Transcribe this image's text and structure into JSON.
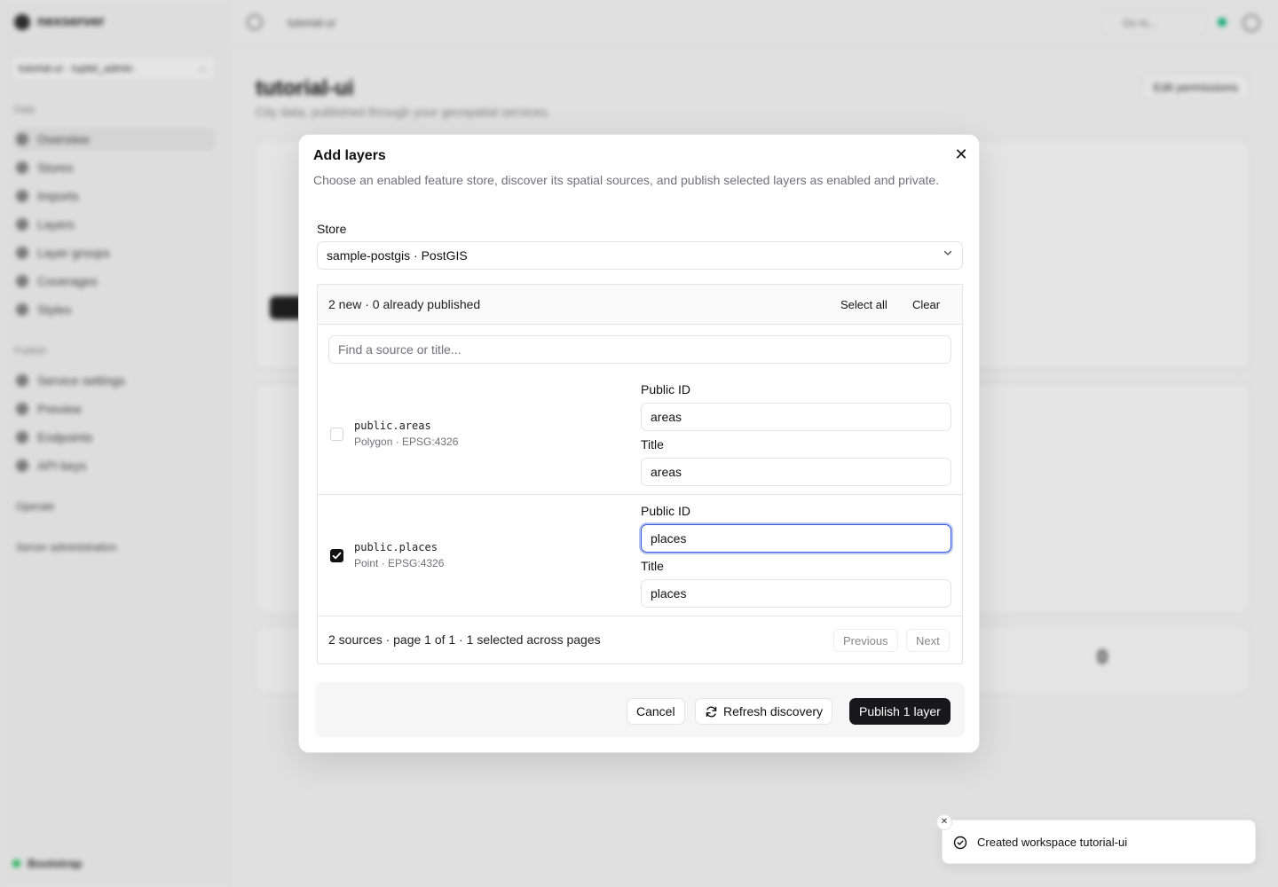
{
  "app": {
    "brand": "nexserver",
    "workspace_switcher": "tutorial-ui · tuplet_admin",
    "nav_group_data": "Data",
    "nav_items": [
      "Overview",
      "Stores",
      "Imports",
      "Layers",
      "Layer groups",
      "Coverages",
      "Styles"
    ],
    "nav_group_publish": "Publish",
    "publish_items": [
      "Service settings",
      "Preview",
      "Endpoints",
      "API keys"
    ],
    "extra_items": [
      "Operate",
      "Server administration"
    ],
    "footer_status": "Bootstrap",
    "breadcrumb": "tutorial-ui",
    "search_placeholder": "Go to...",
    "page_title": "tutorial-ui",
    "page_subtitle": "City data, published through your geospatial services.",
    "edit_permissions": "Edit permissions"
  },
  "dialog": {
    "title": "Add layers",
    "description": "Choose an enabled feature store, discover its spatial sources, and publish selected layers as enabled and private.",
    "store_label": "Store",
    "store_value": "sample-postgis · PostGIS",
    "summary": "2 new · 0 already published",
    "select_all": "Select all",
    "clear": "Clear",
    "find_placeholder": "Find a source or title...",
    "sources": [
      {
        "name": "public.areas",
        "meta": "Polygon · EPSG:4326",
        "checked": false,
        "public_id_label": "Public ID",
        "public_id": "areas",
        "title_label": "Title",
        "title": "areas"
      },
      {
        "name": "public.places",
        "meta": "Point · EPSG:4326",
        "checked": true,
        "public_id_label": "Public ID",
        "public_id": "places",
        "title_label": "Title",
        "title": "places"
      }
    ],
    "pager_text": "2 sources · page 1 of 1 · 1 selected across pages",
    "previous": "Previous",
    "next": "Next",
    "cancel": "Cancel",
    "refresh": "Refresh discovery",
    "publish": "Publish 1 layer"
  },
  "toast": {
    "message": "Created workspace tutorial-ui"
  },
  "colors": {
    "primary": "#18181b",
    "focus_ring": "#3b5bdb",
    "status_green": "#22c55e"
  },
  "icons": [
    "close-icon",
    "chevron-down-icon",
    "check-icon",
    "refresh-icon",
    "check-circle-icon"
  ]
}
